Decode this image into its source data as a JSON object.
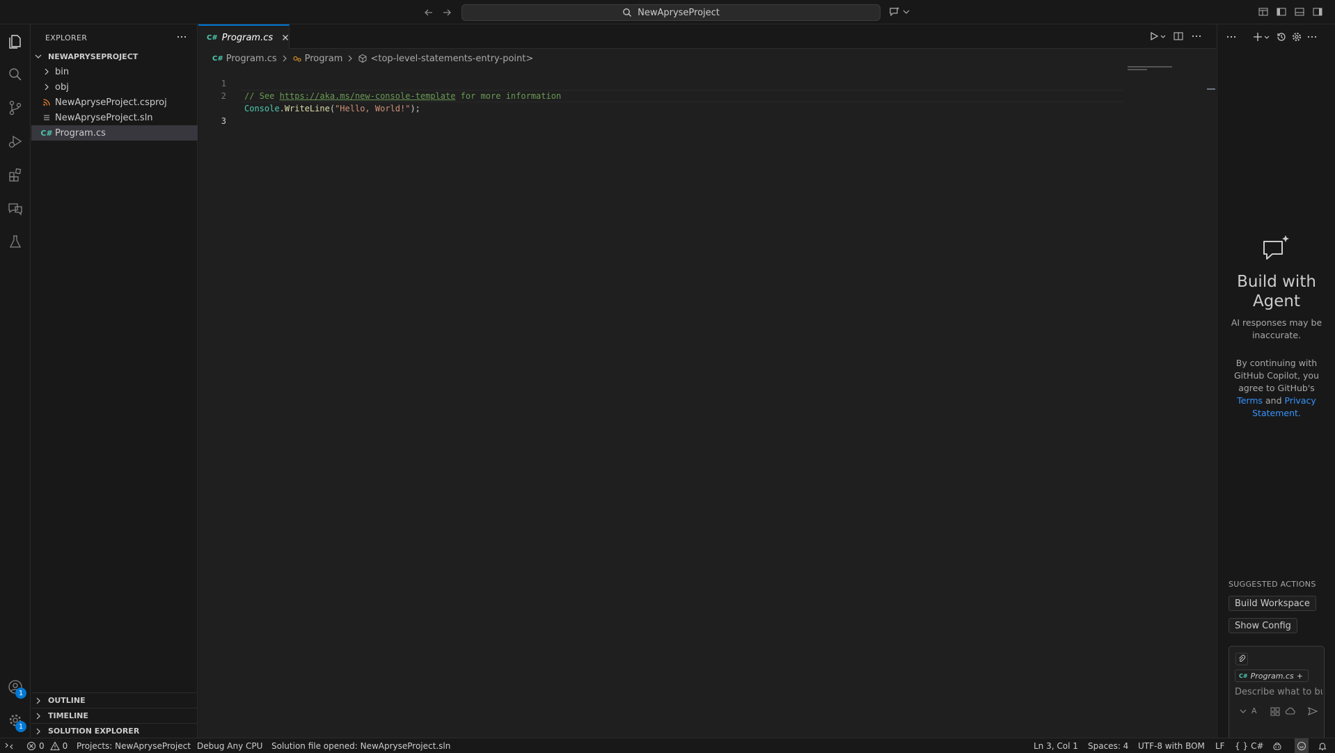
{
  "titlebar": {
    "search_text": "NewApryseProject"
  },
  "activity": {
    "account_badge": "1",
    "settings_badge": "1"
  },
  "explorer": {
    "title": "EXPLORER",
    "root": "NEWAPRYSEPROJECT",
    "items": [
      {
        "label": "bin",
        "kind": "folder"
      },
      {
        "label": "obj",
        "kind": "folder"
      },
      {
        "label": "NewApryseProject.csproj",
        "kind": "csproj"
      },
      {
        "label": "NewApryseProject.sln",
        "kind": "sln"
      },
      {
        "label": "Program.cs",
        "kind": "cs"
      }
    ],
    "sections": [
      "OUTLINE",
      "TIMELINE",
      "SOLUTION EXPLORER"
    ]
  },
  "editor": {
    "tab_label": "Program.cs",
    "breadcrumb": [
      "Program.cs",
      "Program",
      "<top-level-statements-entry-point>"
    ],
    "line_numbers": [
      "1",
      "2",
      "3"
    ],
    "line1": {
      "prefix": "// See ",
      "link": "https://aka.ms/new-console-template",
      "suffix": " for more information"
    },
    "line2": {
      "class": "Console",
      "dot": ".",
      "method": "WriteLine",
      "open": "(",
      "string": "\"Hello, World!\"",
      "close": ");"
    }
  },
  "chat": {
    "title": "Build with Agent",
    "disclaimer": "AI responses may be inaccurate.",
    "terms_prefix": "By continuing with GitHub Copilot, you agree to GitHub's ",
    "terms_link": "Terms",
    "terms_and": " and ",
    "privacy_link": "Privacy Statement",
    "terms_end": ".",
    "suggested_title": "SUGGESTED ACTIONS",
    "actions": [
      "Build Workspace",
      "Show Config"
    ],
    "context_chip": "Program.cs",
    "input_placeholder": "Describe what to build",
    "mode_label": "A"
  },
  "statusbar": {
    "errors": "0",
    "warnings": "0",
    "projects": "Projects: NewApryseProject",
    "debug": "Debug Any CPU",
    "message": "Solution file opened: NewApryseProject.sln",
    "position": "Ln 3, Col 1",
    "spaces": "Spaces: 4",
    "encoding": "UTF-8 with BOM",
    "eol": "LF",
    "language": "C#",
    "braces": "{ }"
  },
  "colors": {
    "accent": "#0078d4",
    "link": "#3794ff",
    "comment": "#6a9955",
    "class": "#4ec9b0",
    "method": "#dcdcaa",
    "string": "#ce9178",
    "csproj_icon": "#e37933",
    "cs_icon": "#4ec9b0"
  }
}
